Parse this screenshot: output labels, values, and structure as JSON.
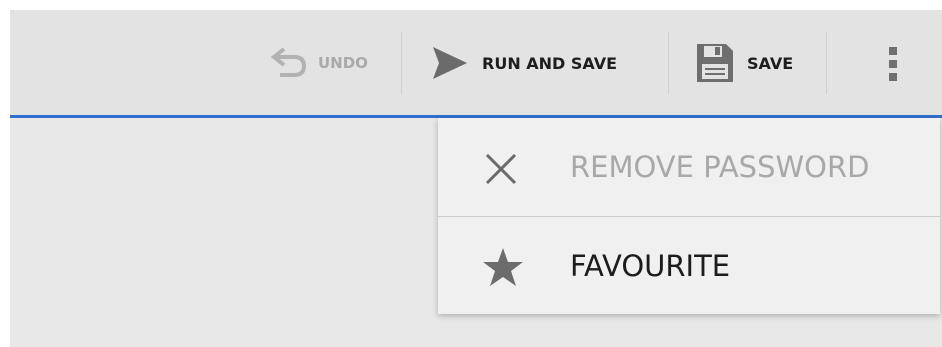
{
  "action_bar": {
    "undo_label": "UNDO",
    "run_and_save_label": "RUN AND SAVE",
    "save_label": "SAVE",
    "icons": {
      "undo": "undo-icon",
      "run": "play-arrow-icon",
      "save": "floppy-disk-icon",
      "overflow": "more-vertical-icon"
    },
    "accent_color": "#2f6fcf"
  },
  "overflow_menu": {
    "items": [
      {
        "label": "REMOVE PASSWORD",
        "icon": "close-icon",
        "enabled": false
      },
      {
        "label": "FAVOURITE",
        "icon": "star-icon",
        "enabled": true
      }
    ]
  }
}
